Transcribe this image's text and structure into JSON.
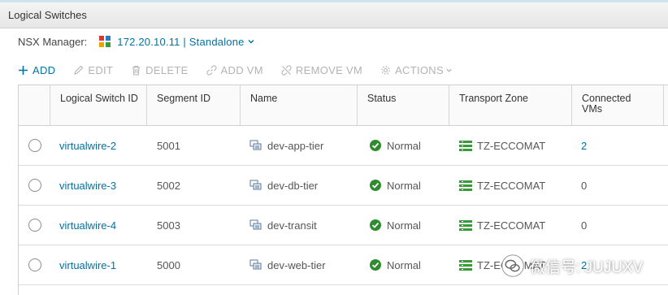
{
  "window": {
    "title": "Logical Switches"
  },
  "manager": {
    "label": "NSX Manager:",
    "value": "172.20.10.11 | Standalone",
    "icon": "nsx-manager-icon"
  },
  "toolbar": {
    "add": "ADD",
    "edit": "EDIT",
    "delete": "DELETE",
    "add_vm": "ADD VM",
    "remove_vm": "REMOVE VM",
    "actions": "ACTIONS"
  },
  "columns": {
    "id": "Logical Switch ID",
    "segment": "Segment ID",
    "name": "Name",
    "status": "Status",
    "zone": "Transport Zone",
    "vms": "Connected VMs"
  },
  "rows": [
    {
      "id": "virtualwire-2",
      "segment": "5001",
      "name": "dev-app-tier",
      "status": "Normal",
      "zone": "TZ-ECCOMAT",
      "vms": "2"
    },
    {
      "id": "virtualwire-3",
      "segment": "5002",
      "name": "dev-db-tier",
      "status": "Normal",
      "zone": "TZ-ECCOMAT",
      "vms": "0"
    },
    {
      "id": "virtualwire-4",
      "segment": "5003",
      "name": "dev-transit",
      "status": "Normal",
      "zone": "TZ-ECCOMAT",
      "vms": "0"
    },
    {
      "id": "virtualwire-1",
      "segment": "5000",
      "name": "dev-web-tier",
      "status": "Normal",
      "zone": "TZ-ECCOMAT",
      "vms": "2"
    }
  ],
  "watermark": {
    "text": "微信号: JUJUXV"
  },
  "colors": {
    "link": "#0072a3",
    "normal": "#2e8b2e",
    "zone": "#3a9a3a",
    "disabled": "#b3b3b3"
  }
}
